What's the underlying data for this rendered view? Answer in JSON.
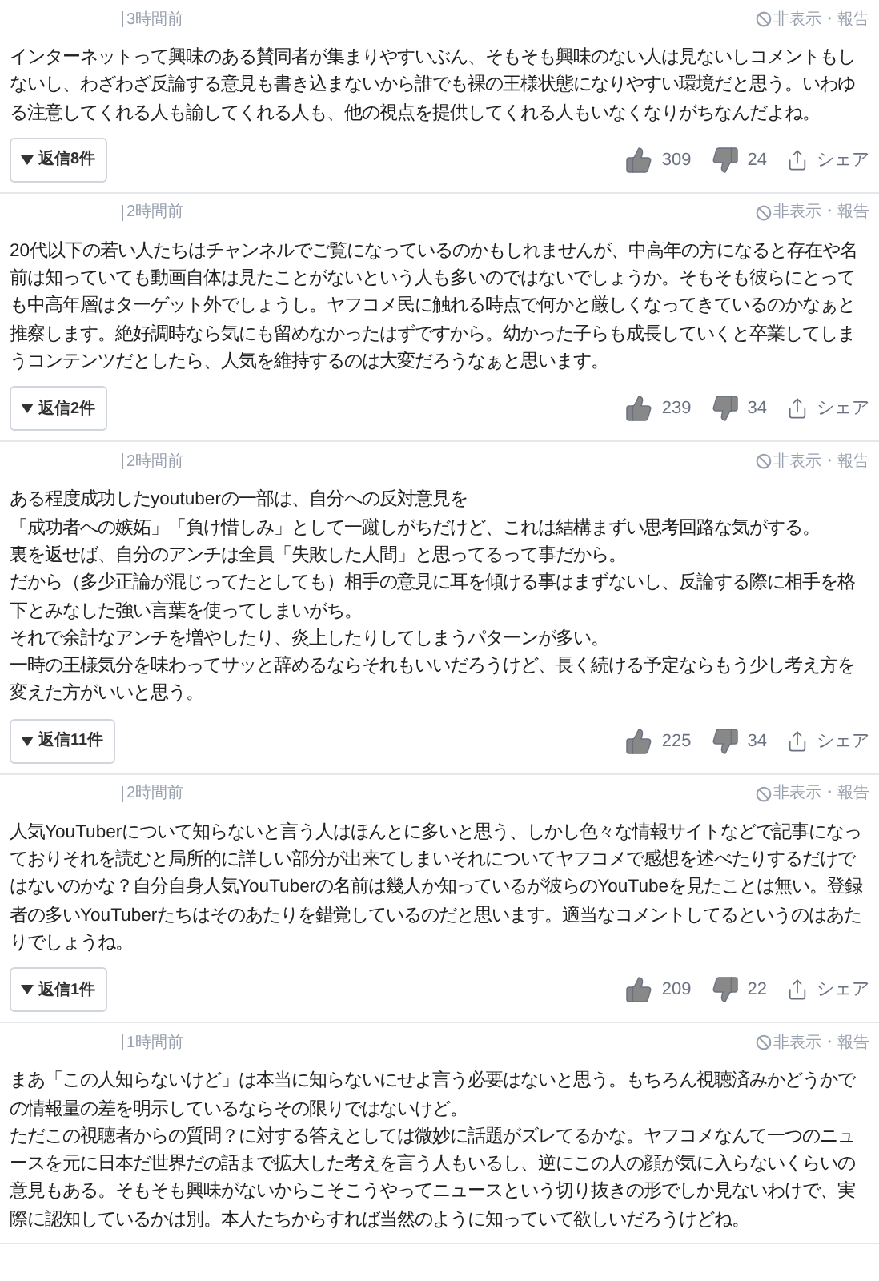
{
  "comments": [
    {
      "time": "3時間前",
      "menu": "非表示・報告",
      "paragraphs": [
        "インターネットって興味のある賛同者が集まりやすいぶん、そもそも興味のない人は見ないしコメントもしないし、わざわざ反論する意見も書き込まないから誰でも裸の王様状態になりやすい環境だと思う。いわゆる注意してくれる人も諭してくれる人も、他の視点を提供してくれる人もいなくなりがちなんだよね。"
      ],
      "replies": "返信8件",
      "likes": "309",
      "dislikes": "24",
      "share": "シェア"
    },
    {
      "time": "2時間前",
      "menu": "非表示・報告",
      "paragraphs": [
        "20代以下の若い人たちはチャンネルでご覧になっているのかもしれませんが、中高年の方になると存在や名前は知っていても動画自体は見たことがないという人も多いのではないでしょうか。そもそも彼らにとっても中高年層はターゲット外でしょうし。ヤフコメ民に触れる時点で何かと厳しくなってきているのかなぁと推察します。絶好調時なら気にも留めなかったはずですから。幼かった子らも成長していくと卒業してしまうコンテンツだとしたら、人気を維持するのは大変だろうなぁと思います。"
      ],
      "replies": "返信2件",
      "likes": "239",
      "dislikes": "34",
      "share": "シェア"
    },
    {
      "time": "2時間前",
      "menu": "非表示・報告",
      "paragraphs": [
        "ある程度成功したyoutuberの一部は、自分への反対意見を",
        "「成功者への嫉妬」「負け惜しみ」として一蹴しがちだけど、これは結構まずい思考回路な気がする。",
        "裏を返せば、自分のアンチは全員「失敗した人間」と思ってるって事だから。",
        "だから（多少正論が混じってたとしても）相手の意見に耳を傾ける事はまずないし、反論する際に相手を格下とみなした強い言葉を使ってしまいがち。",
        "それで余計なアンチを増やしたり、炎上したりしてしまうパターンが多い。",
        "一時の王様気分を味わってサッと辞めるならそれもいいだろうけど、長く続ける予定ならもう少し考え方を変えた方がいいと思う。"
      ],
      "replies": "返信11件",
      "likes": "225",
      "dislikes": "34",
      "share": "シェア"
    },
    {
      "time": "2時間前",
      "menu": "非表示・報告",
      "paragraphs": [
        "人気YouTuberについて知らないと言う人はほんとに多いと思う、しかし色々な情報サイトなどで記事になっておりそれを読むと局所的に詳しい部分が出来てしまいそれについてヤフコメで感想を述べたりするだけではないのかな？自分自身人気YouTuberの名前は幾人か知っているが彼らのYouTubeを見たことは無い。登録者の多いYouTuberたちはそのあたりを錯覚しているのだと思います。適当なコメントしてるというのはあたりでしょうね。"
      ],
      "replies": "返信1件",
      "likes": "209",
      "dislikes": "22",
      "share": "シェア"
    },
    {
      "time": "1時間前",
      "menu": "非表示・報告",
      "paragraphs": [
        "まあ「この人知らないけど」は本当に知らないにせよ言う必要はないと思う。もちろん視聴済みかどうかでの情報量の差を明示しているならその限りではないけど。",
        "ただこの視聴者からの質問？に対する答えとしては微妙に話題がズレてるかな。ヤフコメなんて一つのニュースを元に日本だ世界だの話まで拡大した考えを言う人もいるし、逆にこの人の顔が気に入らないくらいの意見もある。そもそも興味がないからこそこうやってニュースという切り抜きの形でしか見ないわけで、実際に認知しているかは別。本人たちからすれば当然のように知っていて欲しいだろうけどね。"
      ]
    }
  ]
}
